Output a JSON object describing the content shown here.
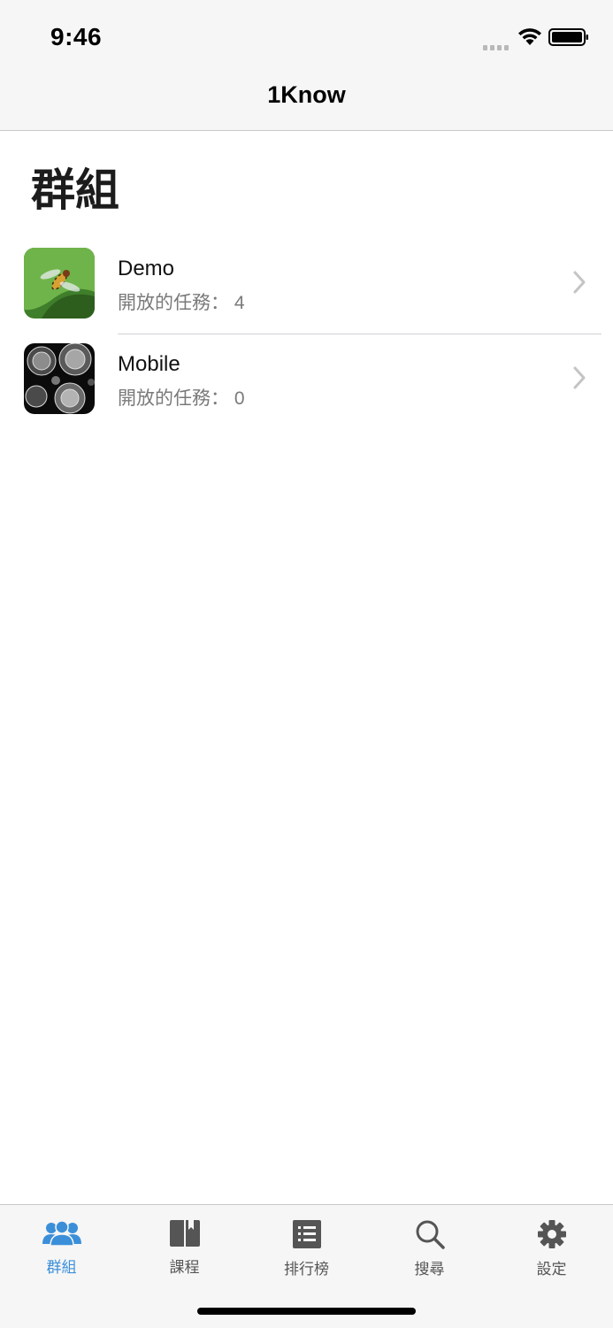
{
  "status_bar": {
    "time": "9:46"
  },
  "nav": {
    "title": "1Know"
  },
  "page": {
    "title": "群組"
  },
  "groups": [
    {
      "name": "Demo",
      "subtitle": "開放的任務： 4",
      "thumbnail": "hoverfly-on-leaf"
    },
    {
      "name": "Mobile",
      "subtitle": "開放的任務： 0",
      "thumbnail": "black-white-dandelion-spheres"
    }
  ],
  "tabbar": {
    "items": [
      {
        "label": "群組",
        "icon": "people-icon",
        "active": true
      },
      {
        "label": "課程",
        "icon": "book-icon",
        "active": false
      },
      {
        "label": "排行榜",
        "icon": "list-icon",
        "active": false
      },
      {
        "label": "搜尋",
        "icon": "search-icon",
        "active": false
      },
      {
        "label": "設定",
        "icon": "gear-icon",
        "active": false
      }
    ]
  },
  "colors": {
    "accent": "#3b8fd9",
    "bar_bg": "#f6f6f6",
    "inactive": "#555555"
  }
}
